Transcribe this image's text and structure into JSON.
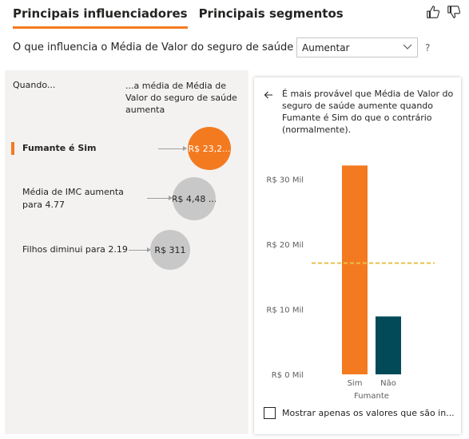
{
  "tabs": [
    {
      "label": "Principais influenciadores",
      "active": true
    },
    {
      "label": "Principais segmentos",
      "active": false
    }
  ],
  "header": {
    "question": "O que influencia o Média de Valor do seguro de saúde a",
    "dropdown_value": "Aumentar",
    "help": "?"
  },
  "left": {
    "col_a": "Quando...",
    "col_b": "...a média de Média de Valor do seguro de saúde aumenta",
    "influencers": [
      {
        "label": "Fumante é Sim",
        "value": "R$ 23,2...",
        "selected": true
      },
      {
        "label": "Média de IMC aumenta para 4.77",
        "value": "R$ 4,48 ...",
        "selected": false
      },
      {
        "label": "Filhos diminui para 2.19",
        "value": "R$ 311",
        "selected": false
      }
    ]
  },
  "detail": {
    "explanation": "É mais provável que Média de Valor do seguro de saúde aumente quando Fumante é Sim do que o contrário (normalmente).",
    "checkbox_label": "Mostrar apenas os valores que são in..."
  },
  "chart_data": {
    "type": "bar",
    "categories": [
      "Sim",
      "Não"
    ],
    "values": [
      32100,
      8900
    ],
    "average_line": 17100,
    "ylim": [
      0,
      33000
    ],
    "yticks": [
      0,
      10000,
      20000,
      30000
    ],
    "ytick_labels": [
      "R$ 0 Mil",
      "R$ 10 Mil",
      "R$ 20 Mil",
      "R$ 30 Mil"
    ],
    "xlabel": "Fumante",
    "ylabel": "",
    "bar_colors": [
      "#f47a20",
      "#034a59"
    ],
    "average_line_color": "#e8c04a",
    "grid": false
  },
  "colors": {
    "accent": "#f47a20",
    "panel_bg": "#f3f2f1",
    "bubble_grey": "#c8c8c8",
    "bar_dark": "#034a59"
  }
}
